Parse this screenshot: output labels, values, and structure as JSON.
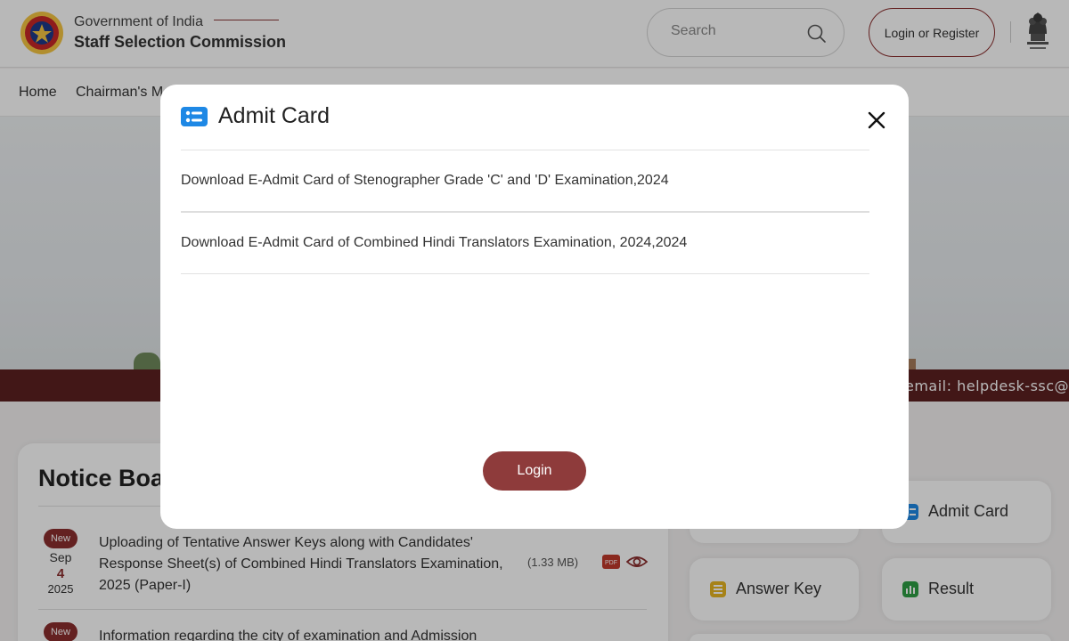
{
  "header": {
    "gov_text": "Government of India",
    "org_name": "Staff Selection Commission",
    "search_placeholder": "Search",
    "login_label": "Login or Register"
  },
  "nav": {
    "items": [
      "Home",
      "Chairman's M"
    ]
  },
  "ticker": {
    "text": "email: helpdesk-ssc@s"
  },
  "notice_board": {
    "title": "Notice Board",
    "items": [
      {
        "badge": "New",
        "month": "Sep",
        "day": "4",
        "year": "2025",
        "text": "Uploading of Tentative Answer Keys along with Candidates' Response Sheet(s) of Combined Hindi Translators Examination, 2025 (Paper-I)",
        "size": "(1.33 MB)"
      },
      {
        "badge": "New",
        "text": "Information regarding the city of examination and Admission"
      }
    ]
  },
  "quick_links": [
    "Admit Card",
    "Answer Key",
    "Result"
  ],
  "modal": {
    "title": "Admit Card",
    "links": [
      "Download E-Admit Card of Stenographer Grade 'C' and 'D' Examination,2024",
      "Download E-Admit Card of Combined Hindi Translators Examination, 2024,2024"
    ],
    "login_label": "Login"
  },
  "colors": {
    "primary": "#8e3b3b",
    "ticker_bg": "#5c2020",
    "admit_icon": "#1e88e5",
    "answer_icon": "#e6b422",
    "result_icon": "#2e9e44"
  }
}
